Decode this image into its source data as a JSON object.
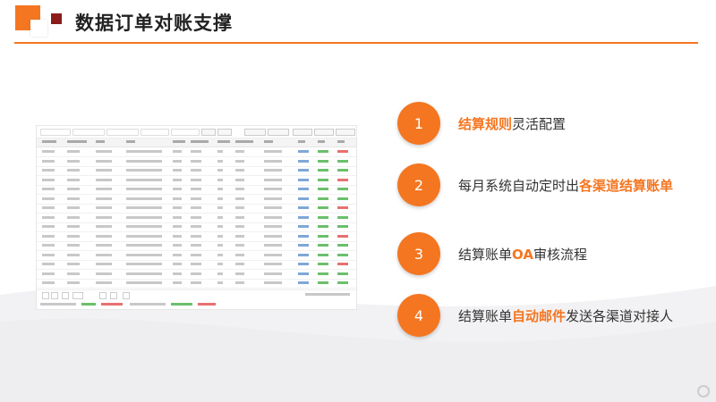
{
  "slide": {
    "title": "数据订单对账支撑",
    "accent_color": "#f47621"
  },
  "steps": [
    {
      "number": "1",
      "parts": [
        {
          "text": "结算规则",
          "hl": true
        },
        {
          "text": "灵活配置",
          "hl": false
        }
      ]
    },
    {
      "number": "2",
      "parts": [
        {
          "text": "每月系统自动定时出",
          "hl": false
        },
        {
          "text": "各渠道结算账单",
          "hl": true
        }
      ]
    },
    {
      "number": "3",
      "parts": [
        {
          "text": "结算账单",
          "hl": false
        },
        {
          "text": "OA",
          "hl": true
        },
        {
          "text": "审核流程",
          "hl": false
        }
      ]
    },
    {
      "number": "4",
      "parts": [
        {
          "text": "结算账单",
          "hl": false
        },
        {
          "text": "自动邮件",
          "hl": true
        },
        {
          "text": "发送各渠道对接人",
          "hl": false
        }
      ]
    }
  ],
  "screenshot": {
    "rows": 15,
    "status_colors": {
      "approved": "#6cbf6c",
      "rejected": "#e87070",
      "link": "#7fa7d8"
    }
  }
}
